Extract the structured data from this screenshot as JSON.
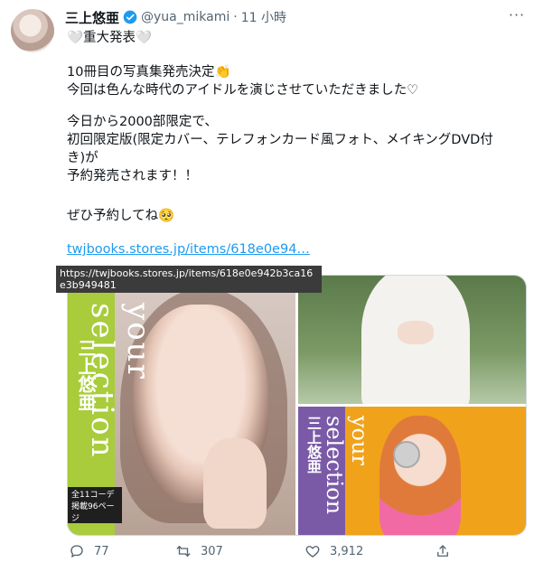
{
  "tweet": {
    "author_name": "三上悠亜",
    "handle": "@yua_mikami",
    "separator": "·",
    "time": "11 小時",
    "more_label": "···",
    "line1": "🤍重大発表🤍",
    "line2": "10冊目の写真集発売決定👏",
    "line3": "今回は色んな時代のアイドルを演じさせていただきました♡",
    "line4": "今日から2000部限定で、",
    "line5": "初回限定版(限定カバー、テレフォンカード風フォト、メイキングDVD付",
    "line6": "き)が",
    "line7": "予約発売されます！！",
    "line8": "ぜひ予約してね🥺",
    "link_text": "twjbooks.stores.jp/items/618e0e94…",
    "tooltip": "https://twjbooks.stores.jp/items/618e0e942b3ca16e3b949481"
  },
  "media": {
    "left_title": "your selection",
    "left_name": "三上悠亜",
    "left_badge": "全11コーデ 掲載96ページ",
    "right_title": "your selection",
    "right_name": "三上悠亜"
  },
  "actions": {
    "reply_count": "77",
    "retweet_count": "307",
    "like_count": "3,912"
  },
  "colors": {
    "link": "#1d9bf0",
    "secondary": "#536471",
    "verified": "#1d9bf0"
  }
}
